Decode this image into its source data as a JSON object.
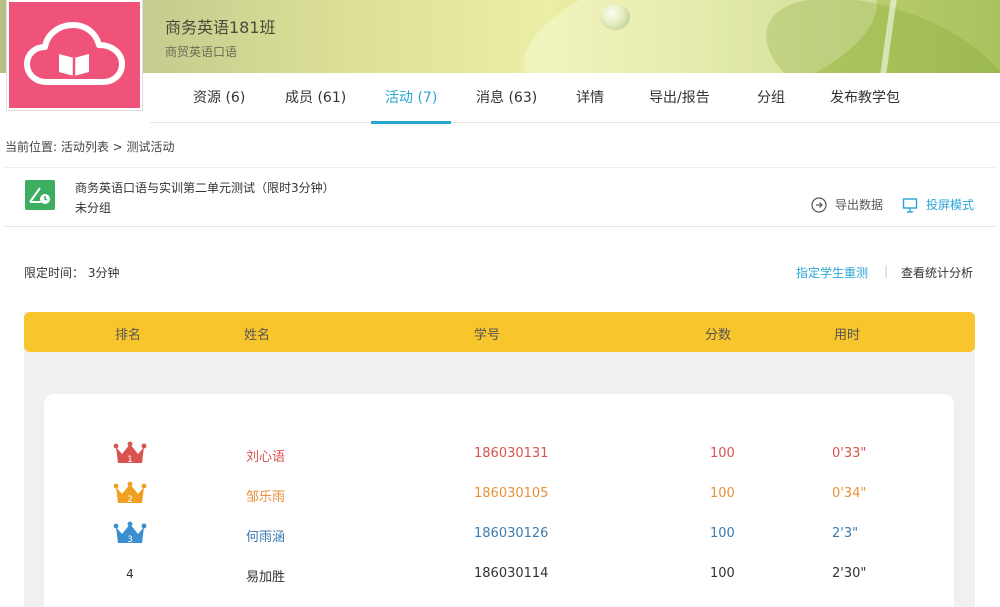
{
  "header": {
    "class_name": "商务英语181班",
    "course_name": "商贸英语口语",
    "logo_icon": "cloud-book-icon",
    "logo_color": "#f0537a"
  },
  "tabs": [
    {
      "label": "资源 (6)",
      "active": false
    },
    {
      "label": "成员 (61)",
      "active": false
    },
    {
      "label": "活动 (7)",
      "active": true
    },
    {
      "label": "消息 (63)",
      "active": false
    },
    {
      "label": "详情",
      "active": false
    },
    {
      "label": "导出/报告",
      "active": false
    },
    {
      "label": "分组",
      "active": false
    },
    {
      "label": "发布教学包",
      "active": false
    }
  ],
  "breadcrumb": "当前位置: 活动列表 > 测试活动",
  "activity": {
    "title": "商务英语口语与实训第二单元测试（限时3分钟）",
    "group": "未分组",
    "export_label": "导出数据",
    "screen_label": "投屏模式"
  },
  "limit_text": "限定时间： 3分钟",
  "links": {
    "retest": "指定学生重测",
    "separator": "|",
    "stats": "查看统计分析"
  },
  "table": {
    "headers": [
      "排名",
      "姓名",
      "学号",
      "分数",
      "用时"
    ],
    "rows": [
      {
        "rank": "1",
        "name": "刘心语",
        "id": "186030131",
        "score": "100",
        "time": "0'33\"",
        "color": "#d9534f",
        "crown": "#d9534f"
      },
      {
        "rank": "2",
        "name": "邹乐雨",
        "id": "186030105",
        "score": "100",
        "time": "0'34\"",
        "color": "#e8913a",
        "crown": "#f0a020"
      },
      {
        "rank": "3",
        "name": "何雨涵",
        "id": "186030126",
        "score": "100",
        "time": "2'3\"",
        "color": "#3b7bb0",
        "crown": "#3b8fcf"
      },
      {
        "rank": "4",
        "name": "易加胜",
        "id": "186030114",
        "score": "100",
        "time": "2'30\"",
        "color": "#333333",
        "crown": null
      }
    ]
  },
  "colors": {
    "accent": "#2aa6d5",
    "table_header": "#f8c52d",
    "activity_icon": "#3dae5f"
  }
}
